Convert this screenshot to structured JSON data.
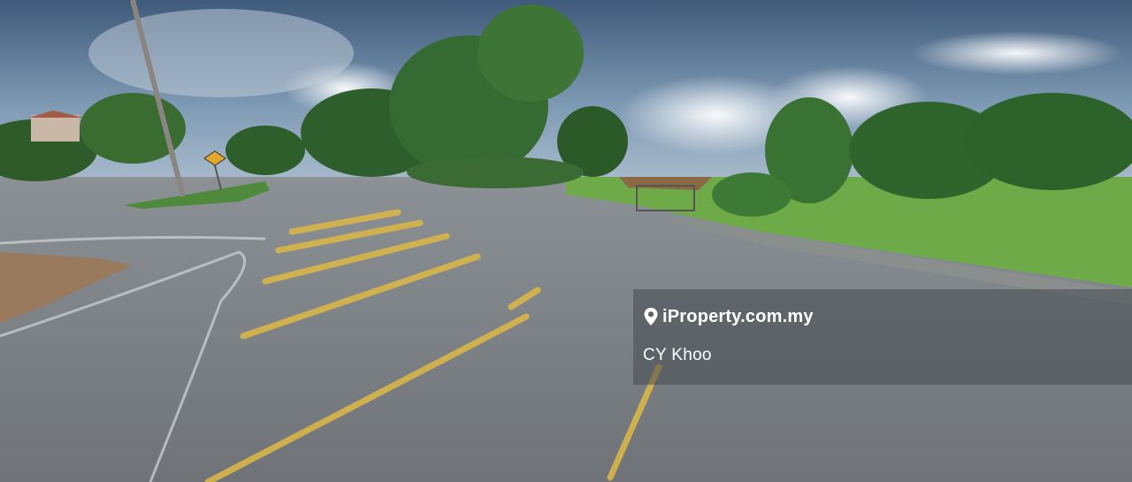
{
  "photo": {
    "subject": "street-view-road-junction",
    "icon": "map-pin-icon"
  },
  "watermark": {
    "brand": "iProperty.com.my",
    "agent_name": "CY Khoo"
  }
}
